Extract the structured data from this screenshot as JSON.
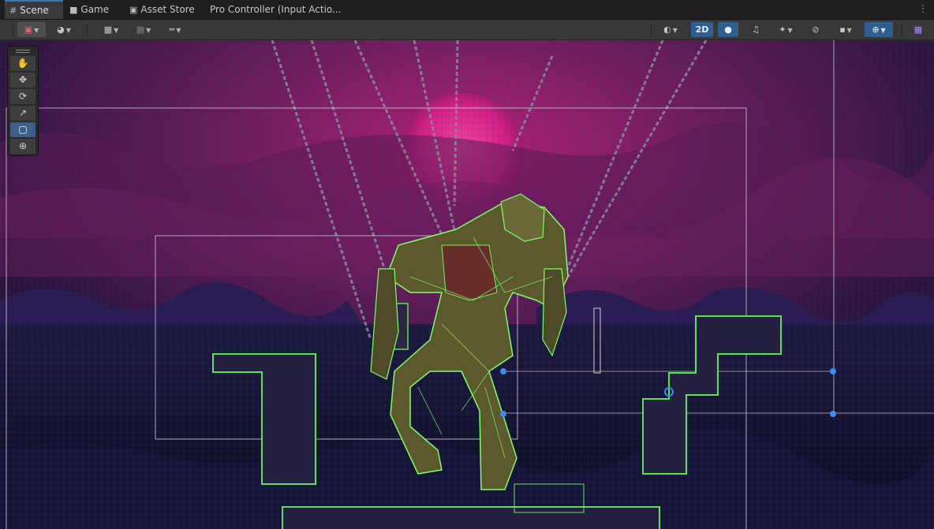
{
  "tabs": [
    {
      "label": "Scene",
      "icon": "hash-icon",
      "active": true
    },
    {
      "label": "Game",
      "icon": "gamepad-icon",
      "active": false
    },
    {
      "label": "Asset Store",
      "icon": "shopping-bag-icon",
      "active": false
    },
    {
      "label": "Pro Controller (Input Actio...",
      "icon": "",
      "active": false
    }
  ],
  "toolbar": {
    "mode_2d_label": "2D",
    "left_tools": [
      "draw-mode-icon",
      "global-icon",
      "grid-snap-icon",
      "increment-snap-icon",
      "ruler-icon"
    ],
    "right_tools": [
      "shading-icon",
      "lighting-icon",
      "audio-icon",
      "effects-icon",
      "hidden-objects-icon",
      "camera-icon",
      "gizmos-icon",
      "grid-icon"
    ]
  },
  "tools": [
    "view-tool-hand-icon",
    "move-tool-icon",
    "rotate-tool-icon",
    "scale-tool-icon",
    "rect-tool-icon",
    "transform-tool-icon"
  ],
  "colors": {
    "accent": "#3a79bb",
    "sky": "#4a1850",
    "moon": "#e0208c",
    "sprite_outline": "#7dff6b",
    "gizmo_handle": "#3a8cf0"
  }
}
